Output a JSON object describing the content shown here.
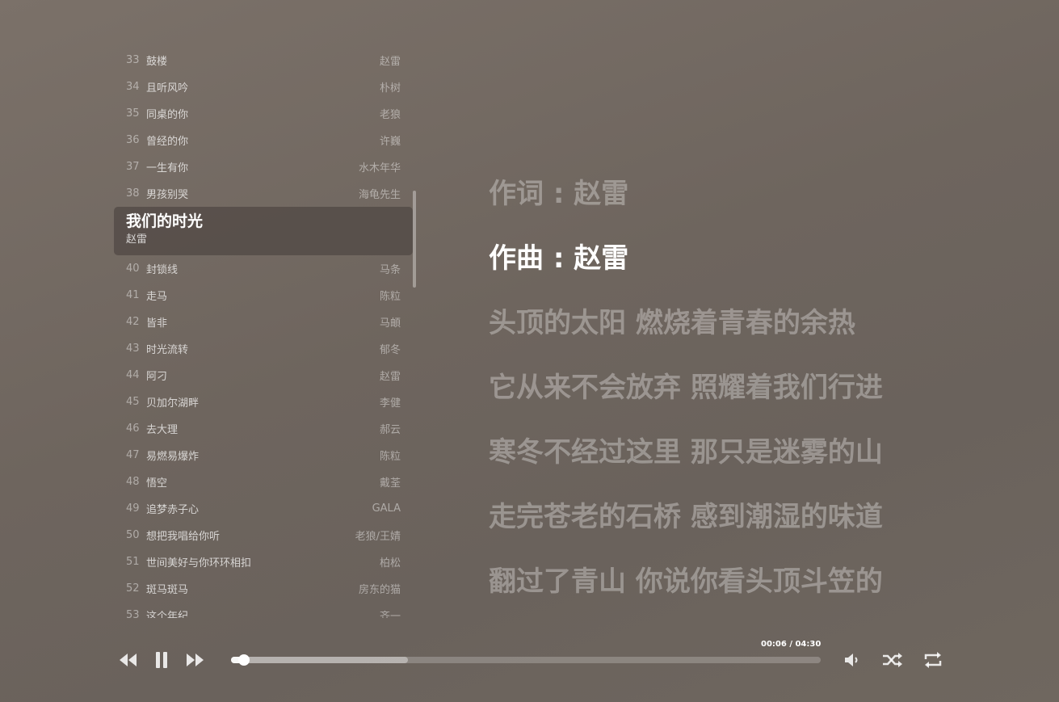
{
  "playlist": {
    "before": [
      {
        "num": "33",
        "title": "鼓楼",
        "artist": "赵雷"
      },
      {
        "num": "34",
        "title": "且听风吟",
        "artist": "朴树"
      },
      {
        "num": "35",
        "title": "同桌的你",
        "artist": "老狼"
      },
      {
        "num": "36",
        "title": "曾经的你",
        "artist": "许巍"
      },
      {
        "num": "37",
        "title": "一生有你",
        "artist": "水木年华"
      },
      {
        "num": "38",
        "title": "男孩别哭",
        "artist": "海龟先生"
      }
    ],
    "current": {
      "title": "我们的时光",
      "artist": "赵雷"
    },
    "after": [
      {
        "num": "40",
        "title": "封锁线",
        "artist": "马条"
      },
      {
        "num": "41",
        "title": "走马",
        "artist": "陈粒"
      },
      {
        "num": "42",
        "title": "皆非",
        "artist": "马頔"
      },
      {
        "num": "43",
        "title": "时光流转",
        "artist": "郁冬"
      },
      {
        "num": "44",
        "title": "阿刁",
        "artist": "赵雷"
      },
      {
        "num": "45",
        "title": "贝加尔湖畔",
        "artist": "李健"
      },
      {
        "num": "46",
        "title": "去大理",
        "artist": "郝云"
      },
      {
        "num": "47",
        "title": "易燃易爆炸",
        "artist": "陈粒"
      },
      {
        "num": "48",
        "title": "悟空",
        "artist": "戴荃"
      },
      {
        "num": "49",
        "title": "追梦赤子心",
        "artist": "GALA"
      },
      {
        "num": "50",
        "title": "想把我唱给你听",
        "artist": "老狼/王婧"
      },
      {
        "num": "51",
        "title": "世间美好与你环环相扣",
        "artist": "柏松"
      },
      {
        "num": "52",
        "title": "斑马斑马",
        "artist": "房东的猫"
      },
      {
        "num": "53",
        "title": "这个年纪",
        "artist": "齐一"
      }
    ]
  },
  "lyrics": {
    "lines": [
      "作词 : 赵雷",
      "作曲 : 赵雷",
      "头顶的太阳 燃烧着青春的余热",
      "它从来不会放弃 照耀着我们行进",
      "寒冬不经过这里 那只是迷雾的山",
      "走完苍老的石桥 感到潮湿的味道",
      "翻过了青山 你说你看头顶斗笠的"
    ],
    "current_index": 1
  },
  "player": {
    "time": "00:06 / 04:30",
    "played_fraction": 0.022,
    "buffered_fraction": 0.3,
    "icons": {
      "prev": "rewind-icon",
      "pause": "pause-icon",
      "next": "fast-forward-icon",
      "volume": "volume-icon",
      "shuffle": "shuffle-icon",
      "repeat": "repeat-icon"
    }
  }
}
